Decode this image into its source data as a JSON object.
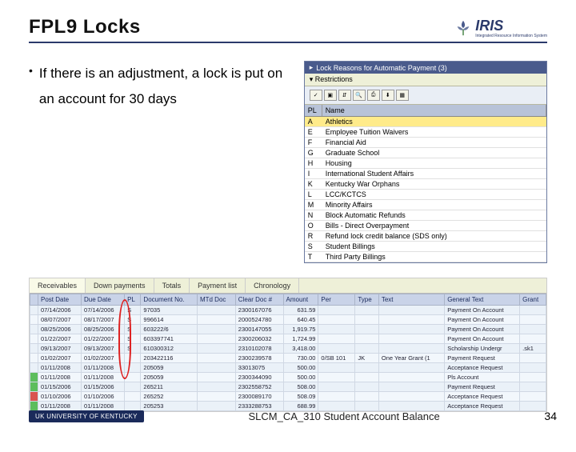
{
  "title": "FPL9 Locks",
  "brand": {
    "name": "IRIS",
    "sub": "Integrated Resource Information System"
  },
  "bullet": "If there is an adjustment, a lock is put on an account for 30 days",
  "lock_window": {
    "title": "Lock Reasons for Automatic Payment (3)",
    "restrictions": "Restrictions",
    "cols": {
      "pl": "PL",
      "name": "Name"
    },
    "rows": [
      {
        "pl": "A",
        "name": "Athletics",
        "sel": true
      },
      {
        "pl": "E",
        "name": "Employee Tuition Waivers"
      },
      {
        "pl": "F",
        "name": "Financial Aid"
      },
      {
        "pl": "G",
        "name": "Graduate School"
      },
      {
        "pl": "H",
        "name": "Housing"
      },
      {
        "pl": "I",
        "name": "International Student Affairs"
      },
      {
        "pl": "K",
        "name": "Kentucky War Orphans"
      },
      {
        "pl": "L",
        "name": "LCC/KCTCS"
      },
      {
        "pl": "M",
        "name": "Minority Affairs"
      },
      {
        "pl": "N",
        "name": "Block Automatic Refunds"
      },
      {
        "pl": "O",
        "name": "Bills - Direct Overpayment"
      },
      {
        "pl": "R",
        "name": "Refund lock credit balance (SDS only)"
      },
      {
        "pl": "S",
        "name": "Student Billings"
      },
      {
        "pl": "T",
        "name": "Third Party Billings"
      }
    ]
  },
  "tabs": [
    "Receivables",
    "Down payments",
    "Totals",
    "Payment list",
    "Chronology"
  ],
  "active_tab": 0,
  "grid": {
    "cols": [
      "",
      "Post Date",
      "Due Date",
      "PL",
      "Document No.",
      "MTd Doc",
      "Clear Doc #",
      "Amount",
      "Per",
      "Type",
      "Text",
      "General Text",
      "Grant"
    ],
    "rows": [
      {
        "st": "",
        "post": "07/14/2006",
        "due": "07/14/2006",
        "pl": "S",
        "doc": "97035",
        "mtd": "",
        "clr": "2300167076",
        "amt": "631.59",
        "per": "",
        "typ": "",
        "txt": "",
        "gen": "Payment On Account",
        "gr": ""
      },
      {
        "st": "",
        "post": "08/07/2007",
        "due": "08/17/2007",
        "pl": "S",
        "doc": "996614",
        "mtd": "",
        "clr": "2000524780",
        "amt": "640.45",
        "per": "",
        "typ": "",
        "txt": "",
        "gen": "Payment On Account",
        "gr": ""
      },
      {
        "st": "",
        "post": "08/25/2006",
        "due": "08/25/2006",
        "pl": "S",
        "doc": "603222/6",
        "mtd": "",
        "clr": "2300147055",
        "amt": "1,919.75",
        "per": "",
        "typ": "",
        "txt": "",
        "gen": "Payment On Account",
        "gr": ""
      },
      {
        "st": "",
        "post": "01/22/2007",
        "due": "01/22/2007",
        "pl": "S",
        "doc": "603397741",
        "mtd": "",
        "clr": "2300206032",
        "amt": "1,724.99",
        "per": "",
        "typ": "",
        "txt": "",
        "gen": "Payment On Account",
        "gr": ""
      },
      {
        "st": "",
        "post": "09/13/2007",
        "due": "09/13/2007",
        "pl": "S",
        "doc": "610300312",
        "mtd": "",
        "clr": "2310102078",
        "amt": "3,418.00",
        "per": "",
        "typ": "",
        "txt": "",
        "gen": "Scholarship Undergr",
        "gr": ".sk1"
      },
      {
        "st": "",
        "post": "01/02/2007",
        "due": "01/02/2007",
        "pl": "",
        "doc": "203422116",
        "mtd": "",
        "clr": "2300239578",
        "amt": "730.00",
        "per": "0/SB 101",
        "typ": "JK",
        "txt": "One Year Grant (1",
        "gen": "Payment Request",
        "gr": ""
      },
      {
        "st": "",
        "post": "01/11/2008",
        "due": "01/11/2008",
        "pl": "",
        "doc": "205059",
        "mtd": "",
        "clr": "33013075",
        "amt": "500.00",
        "per": "",
        "typ": "",
        "txt": "",
        "gen": "Acceptance Request",
        "gr": ""
      },
      {
        "st": "grn",
        "post": "01/11/2008",
        "due": "01/11/2008",
        "pl": "",
        "doc": "205059",
        "mtd": "",
        "clr": "2300344090",
        "amt": "500.00",
        "per": "",
        "typ": "",
        "txt": "",
        "gen": "Pls Account",
        "gr": ""
      },
      {
        "st": "grn",
        "post": "01/15/2006",
        "due": "01/15/2006",
        "pl": "",
        "doc": "265211",
        "mtd": "",
        "clr": "2302558752",
        "amt": "508.00",
        "per": "",
        "typ": "",
        "txt": "",
        "gen": "Payment Request",
        "gr": ""
      },
      {
        "st": "red",
        "post": "01/10/2006",
        "due": "01/10/2006",
        "pl": "",
        "doc": "265252",
        "mtd": "",
        "clr": "2300089170",
        "amt": "508.09",
        "per": "",
        "typ": "",
        "txt": "",
        "gen": "Acceptance Request",
        "gr": ""
      },
      {
        "st": "grn",
        "post": "01/11/2008",
        "due": "01/11/2008",
        "pl": "",
        "doc": "205253",
        "mtd": "",
        "clr": "2333288753",
        "amt": "688.99",
        "per": "",
        "typ": "",
        "txt": "",
        "gen": "Acceptance Request",
        "gr": ""
      }
    ]
  },
  "footer": {
    "badge": "UK UNIVERSITY OF KENTUCKY",
    "course": "SLCM_CA_310 Student Account Balance",
    "page": "34"
  }
}
